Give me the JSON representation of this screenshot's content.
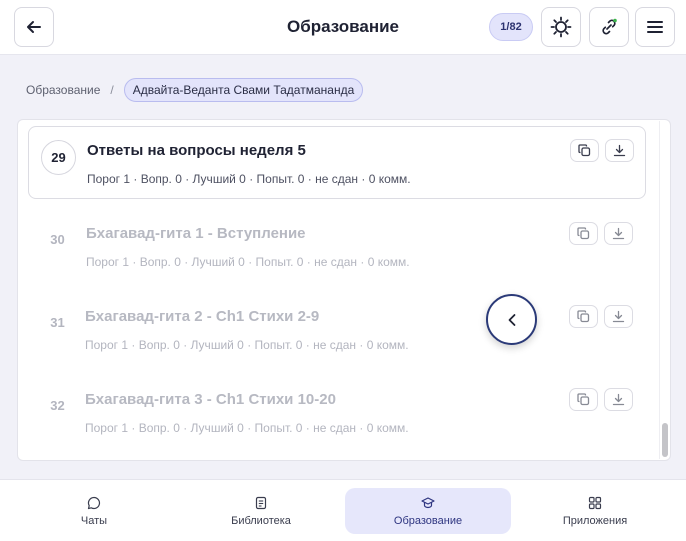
{
  "header": {
    "title": "Образование",
    "counter": "1/82"
  },
  "breadcrumb": {
    "root": "Образование",
    "separator": "/",
    "current": "Адвайта-Веданта Свами Тадатмананда"
  },
  "lessons": [
    {
      "number": "29",
      "title": "Ответы на вопросы неделя 5",
      "meta": "Порог 1 · Вопр. 0 · Лучший 0 · Попыт. 0 · не сдан · 0 комм.",
      "active": true
    },
    {
      "number": "30",
      "title": "Бхагавад-гита 1 - Вступление",
      "meta": "Порог 1 · Вопр. 0 · Лучший 0 · Попыт. 0 · не сдан · 0 комм.",
      "active": false
    },
    {
      "number": "31",
      "title": "Бхагавад-гита 2 - Ch1 Стихи 2-9",
      "meta": "Порог 1 · Вопр. 0 · Лучший 0 · Попыт. 0 · не сдан · 0 комм.",
      "active": false
    },
    {
      "number": "32",
      "title": "Бхагавад-гита 3 - Ch1 Стихи 10-20",
      "meta": "Порог 1 · Вопр. 0 · Лучший 0 · Попыт. 0 · не сдан · 0 комм.",
      "active": false
    }
  ],
  "bottom_nav": {
    "chats": "Чаты",
    "library": "Библиотека",
    "education": "Образование",
    "apps": "Приложения"
  },
  "colors": {
    "accent": "#2b3a78",
    "active_bg": "#e6e7fb"
  }
}
